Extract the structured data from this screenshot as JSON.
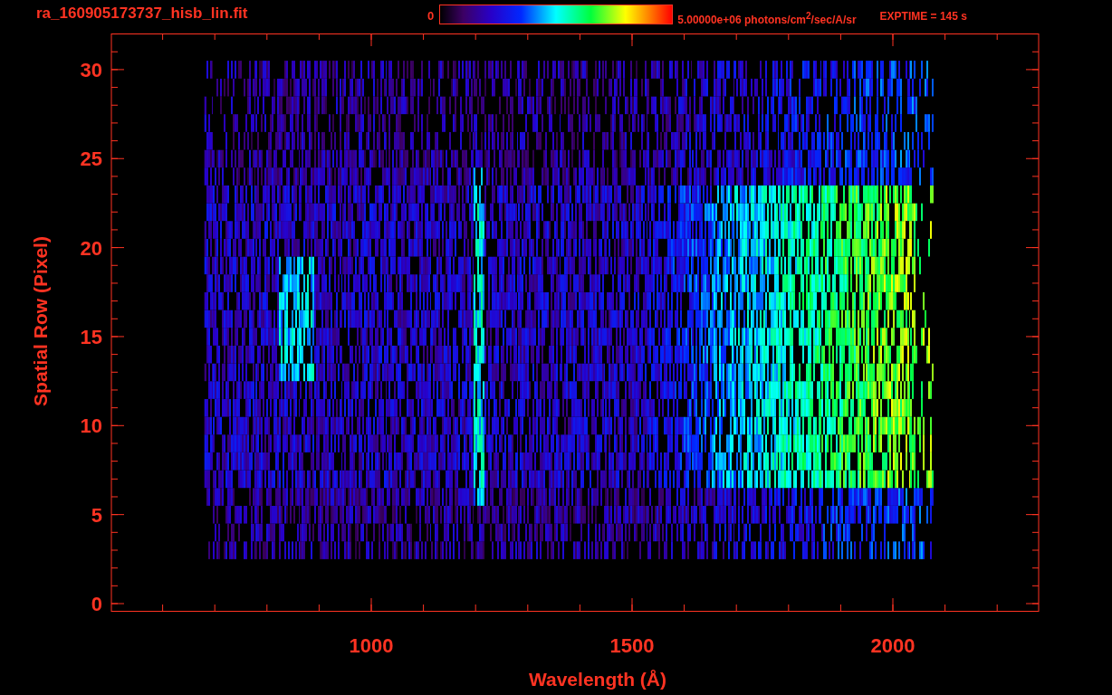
{
  "title": "ra_160905173737_hisb_lin.fit",
  "colorbar": {
    "min_label": "0",
    "max_label": "5.00000e+06 photons/cm$^{2}$/sec/A/sr"
  },
  "exposure": "EXPTIME = 145 s",
  "plot": {
    "xlabel": "Wavelength (Å)",
    "ylabel": "Spatial Row (Pixel)",
    "xticks": [
      "1000",
      "1500",
      "2000"
    ],
    "yticks": [
      "30",
      "25",
      "20",
      "15",
      "10",
      "5",
      "0"
    ]
  }
}
